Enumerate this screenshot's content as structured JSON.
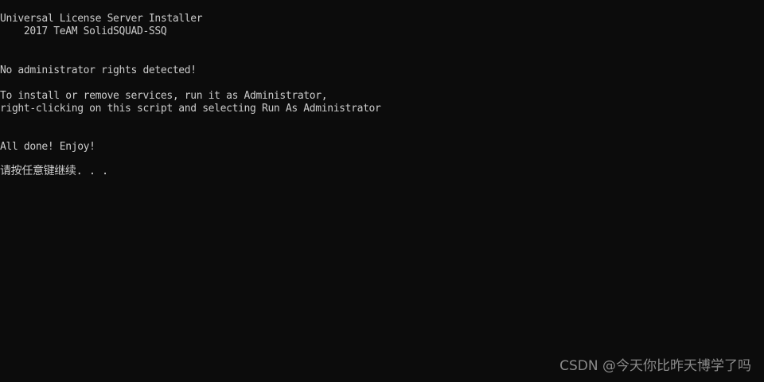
{
  "console": {
    "lines": [
      "Universal License Server Installer",
      "    2017 TeAM SolidSQUAD-SSQ",
      "No administrator rights detected!",
      "To install or remove services, run it as Administrator,",
      "right-clicking on this script and selecting Run As Administrator",
      "All done! Enjoy!",
      "请按任意键继续. . ."
    ]
  },
  "watermark": "CSDN @今天你比昨天博学了吗",
  "colors": {
    "background": "#0c0c0c",
    "text": "#cccccc",
    "watermark": "#8a8a8a"
  }
}
